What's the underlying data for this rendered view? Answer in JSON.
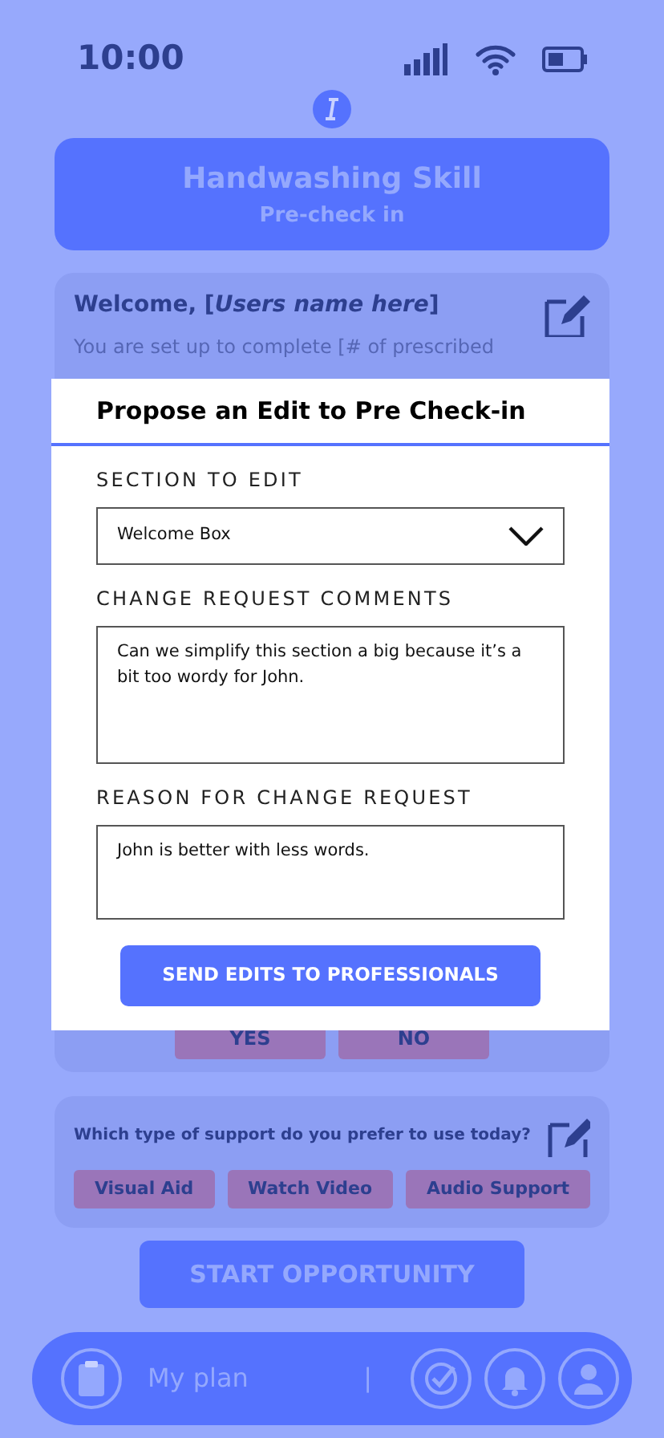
{
  "status_bar": {
    "time": "10:00"
  },
  "header": {
    "title": "Handwashing Skill",
    "subtitle": "Pre-check in"
  },
  "welcome": {
    "greeting": "Welcome, [*Users name here*]",
    "body": "You are set up to complete [# of prescribed",
    "answers": [
      "YES",
      "NO"
    ]
  },
  "support": {
    "question": "Which type of support do you prefer to use today?",
    "options": [
      "Visual Aid",
      "Watch Video",
      "Audio Support"
    ]
  },
  "start_button": "START OPPORTUNITY",
  "bottom_nav": {
    "label": "My plan",
    "separator": "|"
  },
  "modal": {
    "title": "Propose an Edit to Pre Check-in",
    "fields": [
      {
        "kind": "select",
        "label": "SECTION TO EDIT",
        "value": "Welcome Box"
      },
      {
        "kind": "textarea",
        "label": "CHANGE REQUEST COMMENTS",
        "value": "Can we simplify this section a big because it’s a bit too wordy for John."
      },
      {
        "kind": "textarea",
        "label": "REASON FOR CHANGE REQUEST",
        "value": "John is better with less words."
      }
    ],
    "submit": "SEND EDITS TO PROFESSIONALS"
  }
}
